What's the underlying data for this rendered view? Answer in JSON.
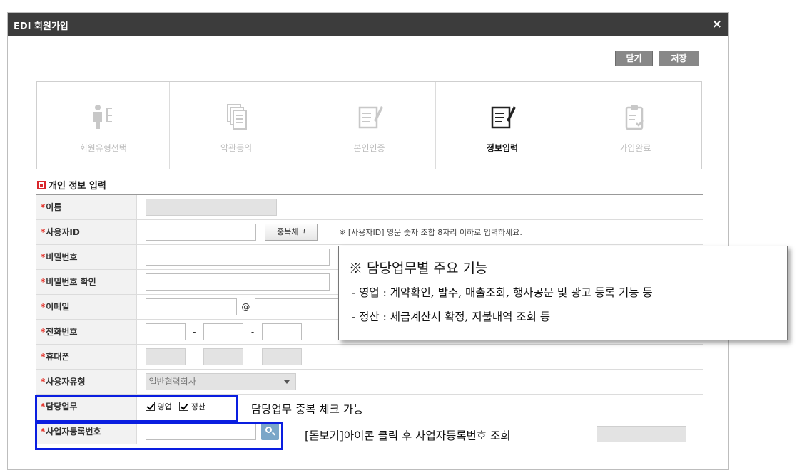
{
  "window": {
    "title": "EDI 회원가입",
    "close_icon": "×"
  },
  "toolbar": {
    "close_label": "닫기",
    "save_label": "저장"
  },
  "steps": [
    {
      "label": "회원유형선택",
      "icon": "member-type-icon",
      "active": false
    },
    {
      "label": "약관동의",
      "icon": "documents-icon",
      "active": false
    },
    {
      "label": "본인인증",
      "icon": "pen-document-icon",
      "active": false
    },
    {
      "label": "정보입력",
      "icon": "pen-document-icon",
      "active": true
    },
    {
      "label": "가입완료",
      "icon": "clipboard-check-icon",
      "active": false
    }
  ],
  "section": {
    "title": "개인 정보 입력"
  },
  "form": {
    "required_mark": "*",
    "name_label": "이름",
    "userid_label": "사용자ID",
    "dup_check_label": "중복체크",
    "userid_hint": "※ [사용자ID] 영문 숫자 조합 8자리 이하로 입력하세요.",
    "password_label": "비밀번호",
    "password_confirm_label": "비밀번호 확인",
    "email_label": "이메일",
    "email_at": "@",
    "phone_label": "전화번호",
    "phone_sep": "-",
    "mobile_label": "휴대폰",
    "usertype_label": "사용자유형",
    "usertype_value": "일반협력회사",
    "duty_label": "담당업무",
    "duty_options": [
      {
        "label": "영업",
        "checked": true
      },
      {
        "label": "정산",
        "checked": true
      }
    ],
    "bizno_label": "사업자등록번호"
  },
  "callout": {
    "title": "※ 담당업무별 주요 기능",
    "lines": [
      "- 영업 : 계약확인, 발주, 매출조회, 행사공문 및 광고 등록 기능 등",
      "- 정산 : 세금계산서 확정, 지불내역 조회 등"
    ]
  },
  "annotations": {
    "duty_note": "담당업무 중복 체크 가능",
    "bizno_note": "[돋보기]아이콘 클릭 후 사업자등록번호 조회"
  },
  "colors": {
    "titlebar": "#3c3c3c",
    "required": "#e4342b",
    "highlight": "#0a1ee0",
    "search_button": "#7aa6c8"
  }
}
